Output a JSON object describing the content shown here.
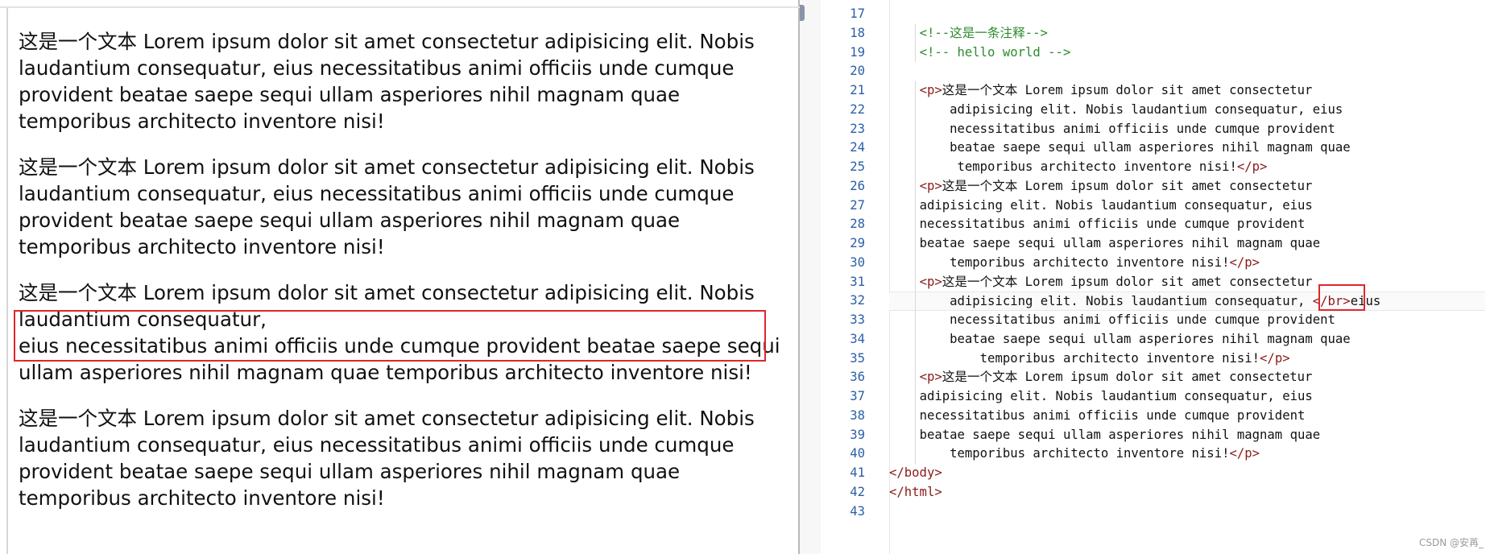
{
  "preview": {
    "paragraphs": [
      {
        "text": "这是一个文本 Lorem ipsum dolor sit amet consectetur adipisicing elit. Nobis laudantium consequatur, eius necessitatibus animi officiis unde cumque provident beatae saepe sequi ullam asperiores nihil magnam quae temporibus architecto inventore nisi!"
      },
      {
        "text": "这是一个文本 Lorem ipsum dolor sit amet consectetur adipisicing elit. Nobis laudantium consequatur, eius necessitatibus animi officiis unde cumque provident beatae saepe sequi ullam asperiores nihil magnam quae temporibus architecto inventore nisi!"
      },
      {
        "text_before_break": "这是一个文本 Lorem ipsum dolor sit amet consectetur adipisicing elit. Nobis laudantium consequatur,",
        "text_after_break": "eius necessitatibus animi officiis unde cumque provident beatae saepe sequi ullam asperiores nihil magnam quae temporibus architecto inventore nisi!"
      },
      {
        "text": "这是一个文本 Lorem ipsum dolor sit amet consectetur adipisicing elit. Nobis laudantium consequatur, eius necessitatibus animi officiis unde cumque provident beatae saepe sequi ullam asperiores nihil magnam quae temporibus architecto inventore nisi!"
      }
    ]
  },
  "editor": {
    "line_numbers": [
      "17",
      "18",
      "19",
      "20",
      "21",
      "22",
      "23",
      "24",
      "25",
      "26",
      "27",
      "28",
      "29",
      "30",
      "31",
      "32",
      "33",
      "34",
      "35",
      "36",
      "37",
      "38",
      "39",
      "40",
      "41",
      "42",
      "43"
    ],
    "lines": [
      {
        "indent": "",
        "tokens": []
      },
      {
        "indent": "    ",
        "tokens": [
          {
            "t": "<!--这是一条注释-->",
            "c": "cmt"
          }
        ]
      },
      {
        "indent": "    ",
        "tokens": [
          {
            "t": "<!-- hello world -->",
            "c": "cmt"
          }
        ]
      },
      {
        "indent": "",
        "tokens": []
      },
      {
        "indent": "    ",
        "tokens": [
          {
            "t": "<p>",
            "c": "tag"
          },
          {
            "t": "这是一个文本 Lorem ipsum dolor sit amet consectetur",
            "c": ""
          }
        ]
      },
      {
        "indent": "        ",
        "tokens": [
          {
            "t": "adipisicing elit. Nobis laudantium consequatur, eius",
            "c": ""
          }
        ]
      },
      {
        "indent": "        ",
        "tokens": [
          {
            "t": "necessitatibus animi officiis unde cumque provident",
            "c": ""
          }
        ]
      },
      {
        "indent": "        ",
        "tokens": [
          {
            "t": "beatae saepe sequi ullam asperiores nihil magnam quae",
            "c": ""
          }
        ]
      },
      {
        "indent": "         ",
        "tokens": [
          {
            "t": "temporibus architecto inventore nisi!",
            "c": ""
          },
          {
            "t": "</p>",
            "c": "tag"
          }
        ]
      },
      {
        "indent": "    ",
        "tokens": [
          {
            "t": "<p>",
            "c": "tag"
          },
          {
            "t": "这是一个文本 Lorem ipsum dolor sit amet consectetur",
            "c": ""
          }
        ]
      },
      {
        "indent": "    ",
        "tokens": [
          {
            "t": "adipisicing elit. Nobis laudantium consequatur, eius",
            "c": ""
          }
        ]
      },
      {
        "indent": "    ",
        "tokens": [
          {
            "t": "necessitatibus animi officiis unde cumque provident",
            "c": ""
          }
        ]
      },
      {
        "indent": "    ",
        "tokens": [
          {
            "t": "beatae saepe sequi ullam asperiores nihil magnam quae",
            "c": ""
          }
        ]
      },
      {
        "indent": "        ",
        "tokens": [
          {
            "t": "temporibus architecto inventore nisi!",
            "c": ""
          },
          {
            "t": "</p>",
            "c": "tag"
          }
        ]
      },
      {
        "indent": "    ",
        "tokens": [
          {
            "t": "<p>",
            "c": "tag"
          },
          {
            "t": "这是一个文本 Lorem ipsum dolor sit amet consectetur",
            "c": ""
          }
        ]
      },
      {
        "indent": "        ",
        "tokens": [
          {
            "t": "adipisicing elit. Nobis laudantium consequatur, ",
            "c": ""
          },
          {
            "t": "</br>",
            "c": "tag"
          },
          {
            "t": "eius",
            "c": ""
          }
        ]
      },
      {
        "indent": "        ",
        "tokens": [
          {
            "t": "necessitatibus animi officiis unde cumque provident",
            "c": ""
          }
        ]
      },
      {
        "indent": "        ",
        "tokens": [
          {
            "t": "beatae saepe sequi ullam asperiores nihil magnam quae",
            "c": ""
          }
        ]
      },
      {
        "indent": "            ",
        "tokens": [
          {
            "t": "temporibus architecto inventore nisi!",
            "c": ""
          },
          {
            "t": "</p>",
            "c": "tag"
          }
        ]
      },
      {
        "indent": "    ",
        "tokens": [
          {
            "t": "<p>",
            "c": "tag"
          },
          {
            "t": "这是一个文本 Lorem ipsum dolor sit amet consectetur",
            "c": ""
          }
        ]
      },
      {
        "indent": "    ",
        "tokens": [
          {
            "t": "adipisicing elit. Nobis laudantium consequatur, eius",
            "c": ""
          }
        ]
      },
      {
        "indent": "    ",
        "tokens": [
          {
            "t": "necessitatibus animi officiis unde cumque provident",
            "c": ""
          }
        ]
      },
      {
        "indent": "    ",
        "tokens": [
          {
            "t": "beatae saepe sequi ullam asperiores nihil magnam quae",
            "c": ""
          }
        ]
      },
      {
        "indent": "        ",
        "tokens": [
          {
            "t": "temporibus architecto inventore nisi!",
            "c": ""
          },
          {
            "t": "</p>",
            "c": "tag"
          }
        ]
      },
      {
        "indent": "",
        "tokens": [
          {
            "t": "</body>",
            "c": "tag"
          }
        ]
      },
      {
        "indent": "",
        "tokens": [
          {
            "t": "</html>",
            "c": "tag"
          }
        ]
      },
      {
        "indent": "",
        "tokens": []
      }
    ],
    "colors": {
      "tag": "#8b1a1a",
      "comment": "#2e8b2e",
      "line_number": "#2b5fa6",
      "highlight": "#e0262b"
    }
  },
  "watermark": "CSDN @安苒_"
}
